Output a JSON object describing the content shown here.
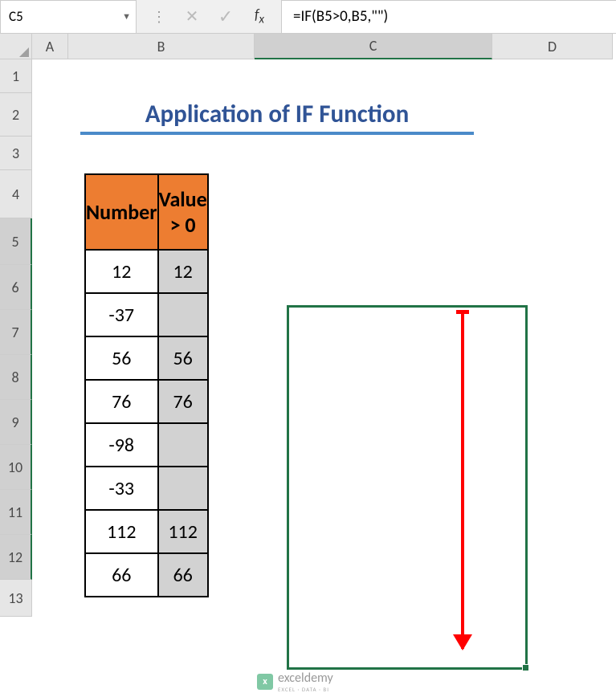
{
  "formula_bar": {
    "cell_ref": "C5",
    "formula": "=IF(B5>0,B5,\"\")"
  },
  "columns": [
    "A",
    "B",
    "C",
    "D"
  ],
  "rows": [
    "1",
    "2",
    "3",
    "4",
    "5",
    "6",
    "7",
    "8",
    "9",
    "10",
    "11",
    "12",
    "13"
  ],
  "title": "Application of IF Function",
  "table": {
    "headers": {
      "number": "Number",
      "value": "Value > 0"
    },
    "data": [
      {
        "number": "12",
        "value": "12"
      },
      {
        "number": "-37",
        "value": ""
      },
      {
        "number": "56",
        "value": "56"
      },
      {
        "number": "76",
        "value": "76"
      },
      {
        "number": "-98",
        "value": ""
      },
      {
        "number": "-33",
        "value": ""
      },
      {
        "number": "112",
        "value": "112"
      },
      {
        "number": "66",
        "value": "66"
      }
    ]
  },
  "watermark": {
    "brand": "exceldemy",
    "tag": "EXCEL · DATA · BI"
  },
  "chart_data": {
    "type": "table",
    "title": "Application of IF Function",
    "columns": [
      "Number",
      "Value > 0"
    ],
    "rows": [
      [
        12,
        12
      ],
      [
        -37,
        null
      ],
      [
        56,
        56
      ],
      [
        76,
        76
      ],
      [
        -98,
        null
      ],
      [
        -33,
        null
      ],
      [
        112,
        112
      ],
      [
        66,
        66
      ]
    ],
    "formula": "=IF(B5>0,B5,\"\")",
    "active_cell": "C5"
  }
}
